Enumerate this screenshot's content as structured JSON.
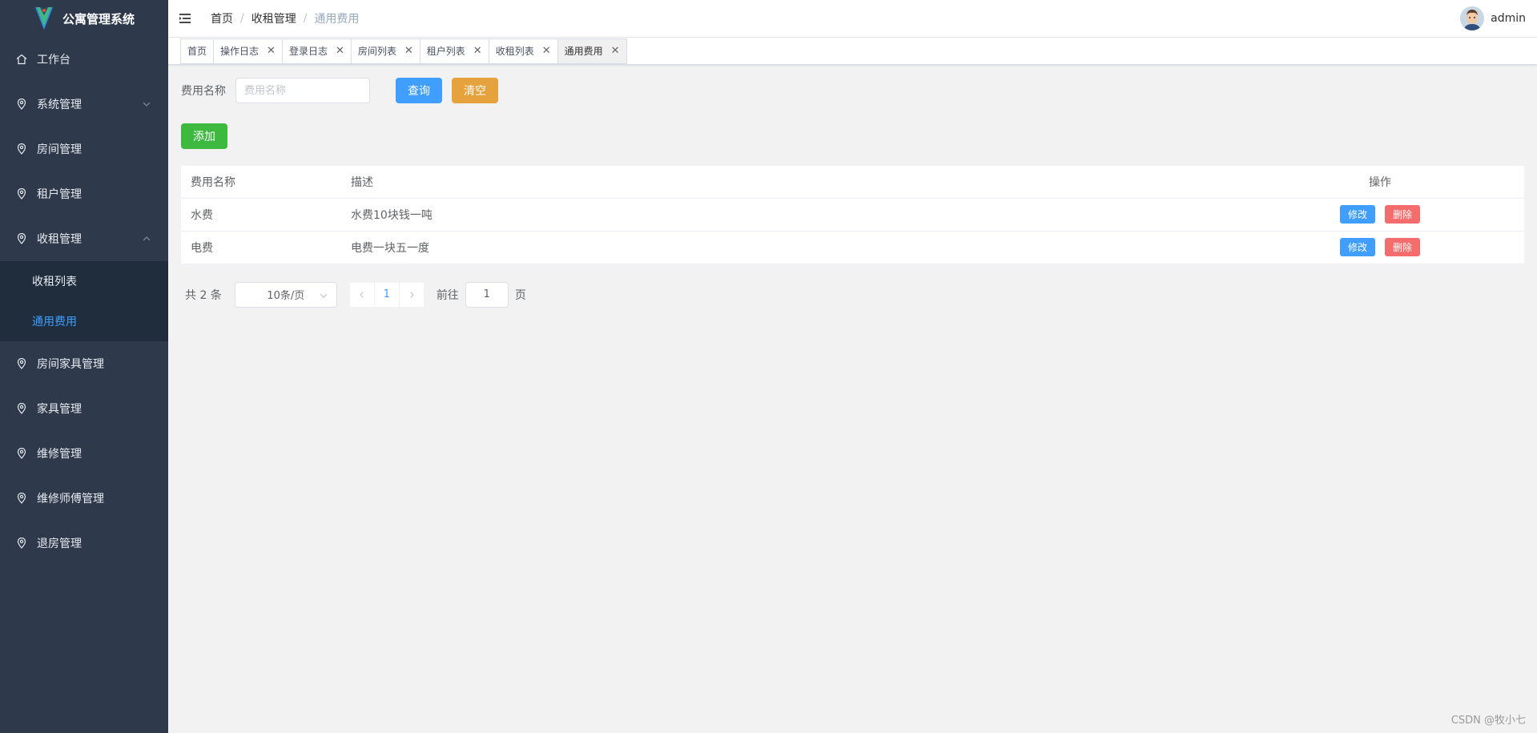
{
  "app": {
    "title": "公寓管理系统"
  },
  "sidebar": {
    "items": [
      {
        "label": "工作台",
        "icon": "home-icon"
      },
      {
        "label": "系统管理",
        "icon": "location-icon",
        "chevron": "down"
      },
      {
        "label": "房间管理",
        "icon": "location-icon"
      },
      {
        "label": "租户管理",
        "icon": "location-icon"
      },
      {
        "label": "收租管理",
        "icon": "location-icon",
        "chevron": "up"
      },
      {
        "label": "房间家具管理",
        "icon": "location-icon"
      },
      {
        "label": "家具管理",
        "icon": "location-icon"
      },
      {
        "label": "维修管理",
        "icon": "location-icon"
      },
      {
        "label": "维修师傅管理",
        "icon": "location-icon"
      },
      {
        "label": "退房管理",
        "icon": "location-icon"
      }
    ],
    "submenu": [
      {
        "label": "收租列表"
      },
      {
        "label": "通用费用"
      }
    ],
    "active_color": "#409eff",
    "bg_color": "#2e3a4c"
  },
  "header": {
    "breadcrumb": [
      "首页",
      "收租管理",
      "通用费用"
    ],
    "separator": "/",
    "username": "admin"
  },
  "tags": [
    {
      "label": "首页",
      "closable": false
    },
    {
      "label": "操作日志",
      "closable": true
    },
    {
      "label": "登录日志",
      "closable": true
    },
    {
      "label": "房间列表",
      "closable": true
    },
    {
      "label": "租户列表",
      "closable": true
    },
    {
      "label": "收租列表",
      "closable": true
    },
    {
      "label": "通用费用",
      "closable": true,
      "active": true
    }
  ],
  "filter": {
    "label": "费用名称",
    "placeholder": "费用名称",
    "query_label": "查询",
    "clear_label": "清空"
  },
  "add_label": "添加",
  "table": {
    "columns": [
      "费用名称",
      "描述",
      "操作"
    ],
    "rows": [
      {
        "name": "水费",
        "desc": "水费10块钱一吨"
      },
      {
        "name": "电费",
        "desc": "电费一块五一度"
      }
    ],
    "edit_label": "修改",
    "delete_label": "删除"
  },
  "pagination": {
    "total_text": "共 2 条",
    "page_size": "10条/页",
    "current_page": "1",
    "goto_label": "前往",
    "goto_value": "1",
    "page_suffix": "页"
  },
  "watermark": "CSDN @牧小七"
}
